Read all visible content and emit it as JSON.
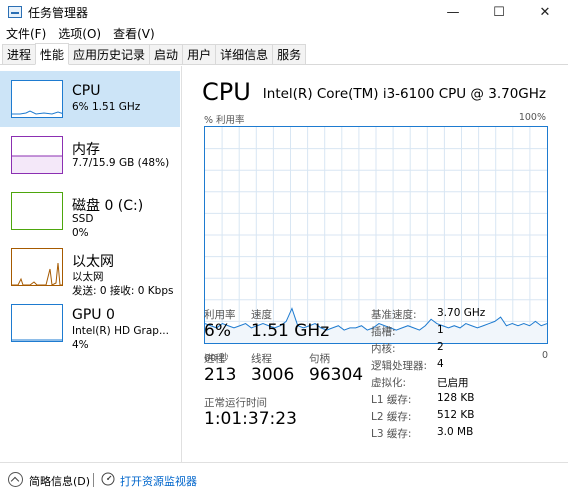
{
  "window": {
    "title": "任务管理器",
    "minimize_glyph": "—",
    "maximize_glyph": "☐",
    "close_glyph": "✕"
  },
  "menu": [
    "文件(F)",
    "选项(O)",
    "查看(V)"
  ],
  "tabs": [
    {
      "label": "进程",
      "active": false
    },
    {
      "label": "性能",
      "active": true
    },
    {
      "label": "应用历史记录",
      "active": false
    },
    {
      "label": "启动",
      "active": false
    },
    {
      "label": "用户",
      "active": false
    },
    {
      "label": "详细信息",
      "active": false
    },
    {
      "label": "服务",
      "active": false
    }
  ],
  "sidebar": [
    {
      "name": "CPU",
      "sub1": "6% 1.51 GHz",
      "sub2": "",
      "color": "#1e7bd0",
      "active": true
    },
    {
      "name": "内存",
      "sub1": "7.7/15.9 GB (48%)",
      "sub2": "",
      "color": "#8b2fb2",
      "active": false
    },
    {
      "name": "磁盘 0 (C:)",
      "sub1": "SSD",
      "sub2": "0%",
      "color": "#4da60c",
      "active": false
    },
    {
      "name": "以太网",
      "sub1": "以太网",
      "sub2": "发送: 0 接收: 0 Kbps",
      "color": "#a65a00",
      "active": false
    },
    {
      "name": "GPU 0",
      "sub1": "Intel(R) HD Grap...",
      "sub2": "4%",
      "color": "#1e7bd0",
      "active": false
    }
  ],
  "main": {
    "title": "CPU",
    "model": "Intel(R) Core(TM) i3-6100 CPU @ 3.70GHz",
    "axis_top_left": "% 利用率",
    "axis_top_right": "100%",
    "axis_bottom_left": "60 秒",
    "axis_bottom_right": "0",
    "stats": {
      "utilization_label": "利用率",
      "utilization_value": "6%",
      "speed_label": "速度",
      "speed_value": "1.51 GHz",
      "processes_label": "进程",
      "processes_value": "213",
      "threads_label": "线程",
      "threads_value": "3006",
      "handles_label": "句柄",
      "handles_value": "96304",
      "uptime_label": "正常运行时间",
      "uptime_value": "1:01:37:23"
    },
    "specs": [
      {
        "label": "基准速度:",
        "value": "3.70 GHz"
      },
      {
        "label": "插槽:",
        "value": "1"
      },
      {
        "label": "内核:",
        "value": "2"
      },
      {
        "label": "逻辑处理器:",
        "value": "4"
      },
      {
        "label": "虚拟化:",
        "value": "已启用"
      },
      {
        "label": "L1 缓存:",
        "value": "128 KB"
      },
      {
        "label": "L2 缓存:",
        "value": "512 KB"
      },
      {
        "label": "L3 缓存:",
        "value": "3.0 MB"
      }
    ]
  },
  "cpu_history": [
    9,
    8,
    7,
    9,
    8,
    7,
    8,
    9,
    7,
    8,
    9,
    8,
    7,
    8,
    10,
    16,
    8,
    7,
    8,
    9,
    7,
    6,
    7,
    8,
    6,
    7,
    7,
    8,
    6,
    7,
    9,
    8,
    7,
    6,
    7,
    8,
    7,
    6,
    8,
    11,
    9,
    8,
    7,
    8,
    7,
    9,
    8,
    7,
    8,
    9,
    10,
    12,
    8,
    9,
    8,
    9,
    8,
    10,
    8,
    9
  ],
  "footer": {
    "fewer_details": "简略信息(D)",
    "open_monitor": "打开资源监视器"
  },
  "colors": {
    "cpu_line": "#1e7bd0",
    "cpu_fill": "#f1f6fb",
    "grid": "#d8e6f3",
    "active_item": "#cce4f7"
  }
}
